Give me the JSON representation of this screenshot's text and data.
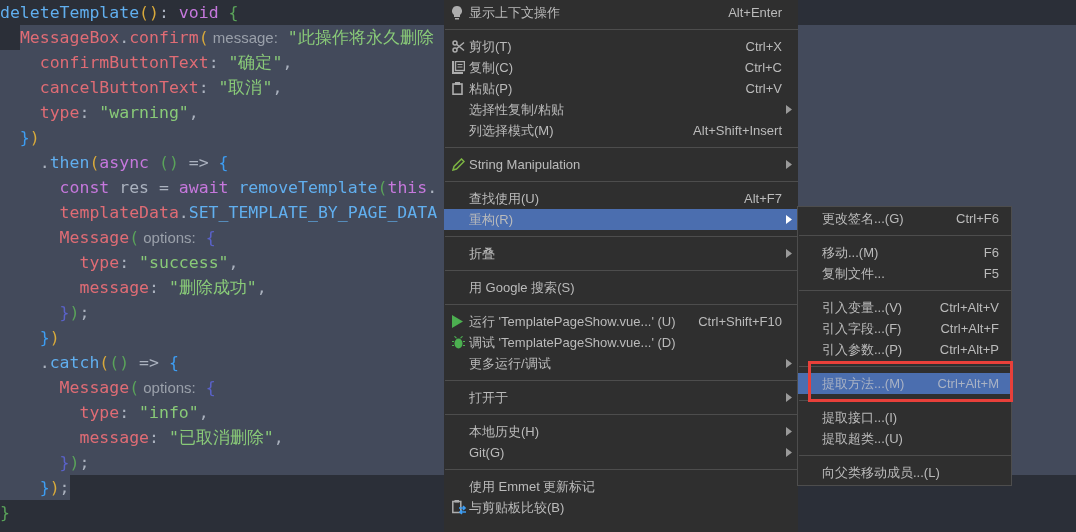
{
  "editor": {
    "lines": [
      {
        "selected": false,
        "tokens": [
          {
            "text": "deleteTemplate",
            "kind": "func"
          },
          {
            "text": "()",
            "kind": "br_yellow"
          },
          {
            "text": ": ",
            "kind": "plain"
          },
          {
            "text": "void",
            "kind": "keyword"
          },
          {
            "text": " {",
            "kind": "br_green"
          }
        ]
      },
      {
        "selected": true,
        "selection_starts": true,
        "tokens": [
          {
            "text": "  MessageBox",
            "kind": "name"
          },
          {
            "text": ".",
            "kind": "plain"
          },
          {
            "text": "confirm",
            "kind": "name"
          },
          {
            "text": "(",
            "kind": "br_yellow"
          },
          {
            "text": " message:",
            "kind": "hint"
          },
          {
            "text": " \"此操作将永久删除",
            "kind": "string"
          }
        ]
      },
      {
        "selected": true,
        "tokens": [
          {
            "text": "    confirmButtonText",
            "kind": "name"
          },
          {
            "text": ": ",
            "kind": "plain"
          },
          {
            "text": "\"确定\"",
            "kind": "string"
          },
          {
            "text": ",",
            "kind": "plain"
          }
        ]
      },
      {
        "selected": true,
        "tokens": [
          {
            "text": "    cancelButtonText",
            "kind": "name"
          },
          {
            "text": ": ",
            "kind": "plain"
          },
          {
            "text": "\"取消\"",
            "kind": "string"
          },
          {
            "text": ",",
            "kind": "plain"
          }
        ]
      },
      {
        "selected": true,
        "tokens": [
          {
            "text": "    type",
            "kind": "name"
          },
          {
            "text": ": ",
            "kind": "plain"
          },
          {
            "text": "\"warning\"",
            "kind": "string"
          },
          {
            "text": ",",
            "kind": "plain"
          }
        ]
      },
      {
        "selected": true,
        "tokens": [
          {
            "text": "  }",
            "kind": "br_blue"
          },
          {
            "text": ")",
            "kind": "br_yellow"
          }
        ]
      },
      {
        "selected": true,
        "tokens": [
          {
            "text": "    .",
            "kind": "plain"
          },
          {
            "text": "then",
            "kind": "func"
          },
          {
            "text": "(",
            "kind": "br_yellow"
          },
          {
            "text": "async",
            "kind": "keyword"
          },
          {
            "text": " ()",
            "kind": "br_green"
          },
          {
            "text": " => ",
            "kind": "plain"
          },
          {
            "text": "{",
            "kind": "br_blue"
          }
        ]
      },
      {
        "selected": true,
        "tokens": [
          {
            "text": "      const",
            "kind": "keyword"
          },
          {
            "text": " res = ",
            "kind": "plain"
          },
          {
            "text": "await",
            "kind": "keyword"
          },
          {
            "text": " removeTemplate",
            "kind": "func"
          },
          {
            "text": "(",
            "kind": "br_green"
          },
          {
            "text": "this",
            "kind": "keyword"
          },
          {
            "text": ".",
            "kind": "plain"
          }
        ]
      },
      {
        "selected": true,
        "tokens": [
          {
            "text": "      templateData",
            "kind": "name"
          },
          {
            "text": ".",
            "kind": "plain"
          },
          {
            "text": "SET_TEMPLATE_BY_PAGE_DATA",
            "kind": "func"
          }
        ]
      },
      {
        "selected": true,
        "tokens": [
          {
            "text": "      Message",
            "kind": "name"
          },
          {
            "text": "(",
            "kind": "br_green"
          },
          {
            "text": " options:",
            "kind": "hint"
          },
          {
            "text": " {",
            "kind": "br_purple"
          }
        ]
      },
      {
        "selected": true,
        "tokens": [
          {
            "text": "        type",
            "kind": "name"
          },
          {
            "text": ": ",
            "kind": "plain"
          },
          {
            "text": "\"success\"",
            "kind": "string"
          },
          {
            "text": ",",
            "kind": "plain"
          }
        ]
      },
      {
        "selected": true,
        "tokens": [
          {
            "text": "        message",
            "kind": "name"
          },
          {
            "text": ": ",
            "kind": "plain"
          },
          {
            "text": "\"删除成功\"",
            "kind": "string"
          },
          {
            "text": ",",
            "kind": "plain"
          }
        ]
      },
      {
        "selected": true,
        "tokens": [
          {
            "text": "      }",
            "kind": "br_purple"
          },
          {
            "text": ")",
            "kind": "br_green"
          },
          {
            "text": ";",
            "kind": "plain"
          }
        ]
      },
      {
        "selected": true,
        "tokens": [
          {
            "text": "    }",
            "kind": "br_blue"
          },
          {
            "text": ")",
            "kind": "br_yellow"
          }
        ]
      },
      {
        "selected": true,
        "tokens": [
          {
            "text": "    .",
            "kind": "plain"
          },
          {
            "text": "catch",
            "kind": "func"
          },
          {
            "text": "(",
            "kind": "br_yellow"
          },
          {
            "text": "()",
            "kind": "br_green"
          },
          {
            "text": " => ",
            "kind": "plain"
          },
          {
            "text": "{",
            "kind": "br_blue"
          }
        ]
      },
      {
        "selected": true,
        "tokens": [
          {
            "text": "      Message",
            "kind": "name"
          },
          {
            "text": "(",
            "kind": "br_green"
          },
          {
            "text": " options:",
            "kind": "hint"
          },
          {
            "text": " {",
            "kind": "br_purple"
          }
        ]
      },
      {
        "selected": true,
        "tokens": [
          {
            "text": "        type",
            "kind": "name"
          },
          {
            "text": ": ",
            "kind": "plain"
          },
          {
            "text": "\"info\"",
            "kind": "string"
          },
          {
            "text": ",",
            "kind": "plain"
          }
        ]
      },
      {
        "selected": true,
        "tokens": [
          {
            "text": "        message",
            "kind": "name"
          },
          {
            "text": ": ",
            "kind": "plain"
          },
          {
            "text": "\"已取消删除\"",
            "kind": "string"
          },
          {
            "text": ",",
            "kind": "plain"
          }
        ]
      },
      {
        "selected": true,
        "tokens": [
          {
            "text": "      }",
            "kind": "br_purple"
          },
          {
            "text": ")",
            "kind": "br_green"
          },
          {
            "text": ";",
            "kind": "plain"
          }
        ]
      },
      {
        "selected": true,
        "selection_ends": true,
        "tokens": [
          {
            "text": "    }",
            "kind": "br_blue"
          },
          {
            "text": ")",
            "kind": "br_yellow"
          },
          {
            "text": ";",
            "kind": "plain"
          }
        ]
      },
      {
        "selected": false,
        "tokens": [
          {
            "text": "}",
            "kind": "br_green"
          }
        ]
      }
    ]
  },
  "context_menu": {
    "sections": [
      {
        "items": [
          {
            "kind": "bulb",
            "label": "显示上下文操作",
            "shortcut": "Alt+Enter",
            "submenu": false,
            "selected": false
          }
        ]
      },
      {
        "items": [
          {
            "kind": "cut",
            "label": "剪切(T)",
            "shortcut": "Ctrl+X",
            "submenu": false,
            "selected": false
          },
          {
            "kind": "copy",
            "label": "复制(C)",
            "shortcut": "Ctrl+C",
            "submenu": false,
            "selected": false
          },
          {
            "kind": "paste",
            "label": "粘贴(P)",
            "shortcut": "Ctrl+V",
            "submenu": false,
            "selected": false
          },
          {
            "kind": "plain",
            "label": "选择性复制/粘贴",
            "submenu": true,
            "selected": false
          },
          {
            "kind": "plain",
            "label": "列选择模式(M)",
            "shortcut": "Alt+Shift+Insert",
            "submenu": false,
            "selected": false
          }
        ]
      },
      {
        "items": [
          {
            "kind": "pencil",
            "label": "String Manipulation",
            "submenu": true,
            "selected": false
          }
        ]
      },
      {
        "items": [
          {
            "kind": "plain",
            "label": "查找使用(U)",
            "shortcut": "Alt+F7",
            "submenu": false,
            "selected": false
          },
          {
            "kind": "plain",
            "label": "重构(R)",
            "submenu": true,
            "selected": true
          }
        ]
      },
      {
        "items": [
          {
            "kind": "plain",
            "label": "折叠",
            "submenu": true,
            "selected": false
          }
        ]
      },
      {
        "items": [
          {
            "kind": "plain",
            "label": "用 Google 搜索(S)",
            "submenu": false,
            "selected": false
          }
        ]
      },
      {
        "items": [
          {
            "kind": "run",
            "label": "运行 'TemplatePageShow.vue...' (U)",
            "shortcut": "Ctrl+Shift+F10",
            "submenu": false,
            "selected": false
          },
          {
            "kind": "debug",
            "label": "调试 'TemplatePageShow.vue...' (D)",
            "submenu": false,
            "selected": false
          },
          {
            "kind": "plain",
            "label": "更多运行/调试",
            "submenu": true,
            "selected": false
          }
        ]
      },
      {
        "items": [
          {
            "kind": "plain",
            "label": "打开于",
            "submenu": true,
            "selected": false
          }
        ]
      },
      {
        "items": [
          {
            "kind": "plain",
            "label": "本地历史(H)",
            "submenu": true,
            "selected": false
          },
          {
            "kind": "plain",
            "label": "Git(G)",
            "submenu": true,
            "selected": false
          }
        ]
      },
      {
        "items": [
          {
            "kind": "plain",
            "label": "使用 Emmet 更新标记",
            "submenu": false,
            "selected": false
          },
          {
            "kind": "compare",
            "label": "与剪贴板比较(B)",
            "submenu": false,
            "selected": false
          }
        ]
      }
    ]
  },
  "refactor_submenu": {
    "sections": [
      {
        "items": [
          {
            "label": "更改签名...(G)",
            "shortcut": "Ctrl+F6",
            "selected": false,
            "marked": false
          }
        ]
      },
      {
        "items": [
          {
            "label": "移动...(M)",
            "shortcut": "F6",
            "selected": false,
            "marked": false
          },
          {
            "label": "复制文件...",
            "shortcut": "F5",
            "selected": false,
            "marked": false
          }
        ]
      },
      {
        "items": [
          {
            "label": "引入变量...(V)",
            "shortcut": "Ctrl+Alt+V",
            "selected": false,
            "marked": false
          },
          {
            "label": "引入字段...(F)",
            "shortcut": "Ctrl+Alt+F",
            "selected": false,
            "marked": false
          },
          {
            "label": "引入参数...(P)",
            "shortcut": "Ctrl+Alt+P",
            "selected": false,
            "marked": false
          }
        ]
      },
      {
        "items": [
          {
            "label": "提取方法...(M)",
            "shortcut": "Ctrl+Alt+M",
            "selected": true,
            "marked": true
          }
        ]
      },
      {
        "items": [
          {
            "label": "提取接口...(I)",
            "selected": false,
            "marked": false
          },
          {
            "label": "提取超类...(U)",
            "selected": false,
            "marked": false
          }
        ]
      },
      {
        "items": [
          {
            "label": "向父类移动成员...(L)",
            "selected": false,
            "marked": false
          }
        ]
      }
    ]
  }
}
